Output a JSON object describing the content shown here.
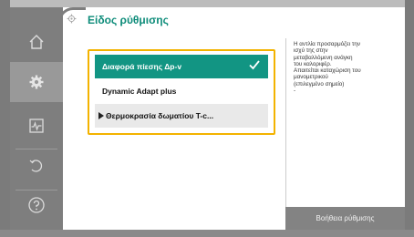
{
  "header": {
    "title": "Είδος ρύθμισης",
    "icon": "gear-icon",
    "accent_color": "#0e8c7a"
  },
  "sidebar": {
    "items": [
      {
        "icon": "home-icon",
        "active": false
      },
      {
        "icon": "gear-icon",
        "active": true
      },
      {
        "icon": "diagnostics-icon",
        "active": false
      },
      {
        "icon": "undo-icon",
        "active": false
      },
      {
        "icon": "help-icon",
        "active": false
      }
    ]
  },
  "control_modes": {
    "focus_color": "#f3b300",
    "selected_color": "#129583",
    "items": [
      {
        "label": "Διαφορά πίεσης Δp-v",
        "selected": true,
        "icon": "check-icon"
      },
      {
        "label": "Dynamic Adapt plus",
        "selected": false
      },
      {
        "label": "Θερμοκρασία δωματίου T-c...",
        "selected": false,
        "icon": "triangle-right-icon"
      }
    ]
  },
  "help_panel": {
    "text": "Η αντλία προσαρμόζει την\nισχύ της στην\nμεταβαλλόμενη ανάγκη\nτου καλοριφέρ.\nΑπαιτείται καταχώριση του\nμανομετρικού\n(επιλεγμένο σημείο)\n-",
    "button_label": "Βοήθεια ρύθμισης"
  }
}
